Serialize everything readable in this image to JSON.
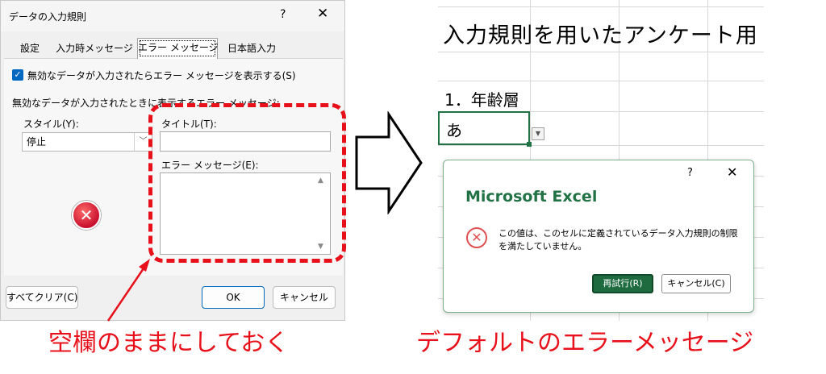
{
  "dialog": {
    "title": "データの入力規則",
    "help_glyph": "?",
    "close_glyph": "✕",
    "tabs": [
      "設定",
      "入力時メッセージ",
      "エラー メッセージ",
      "日本語入力"
    ],
    "checkbox_label": "無効なデータが入力されたらエラー メッセージを表示する(S)",
    "section_label": "無効なデータが入力されたときに表示するエラー メッセージ:",
    "style_label": "スタイル(Y):",
    "style_value": "停止",
    "title_label": "タイトル(T):",
    "title_value": "",
    "message_label": "エラー メッセージ(E):",
    "message_value": "",
    "buttons": {
      "clear": "すべてクリア(C)",
      "ok": "OK",
      "cancel": "キャンセル"
    }
  },
  "caption_left": "空欄のままにしておく",
  "sheet": {
    "title": "入力規則を用いたアンケート用",
    "question": "1．年齢層",
    "cell_value": "あ"
  },
  "excel_popup": {
    "help_glyph": "?",
    "close_glyph": "✕",
    "title": "Microsoft Excel",
    "message": "この値は、このセルに定義されているデータ入力規則の制限を満たしていません。",
    "retry": "再試行(R)",
    "cancel": "キャンセル(C)"
  },
  "caption_right": "デフォルトのエラーメッセージ",
  "colors": {
    "accent_red": "#e8101a",
    "excel_green": "#217346",
    "checkbox_blue": "#0067c0"
  },
  "icons": [
    "checkbox-checked-icon",
    "chevron-down-icon",
    "error-stop-icon",
    "error-circle-icon",
    "dropdown-arrow-icon"
  ]
}
